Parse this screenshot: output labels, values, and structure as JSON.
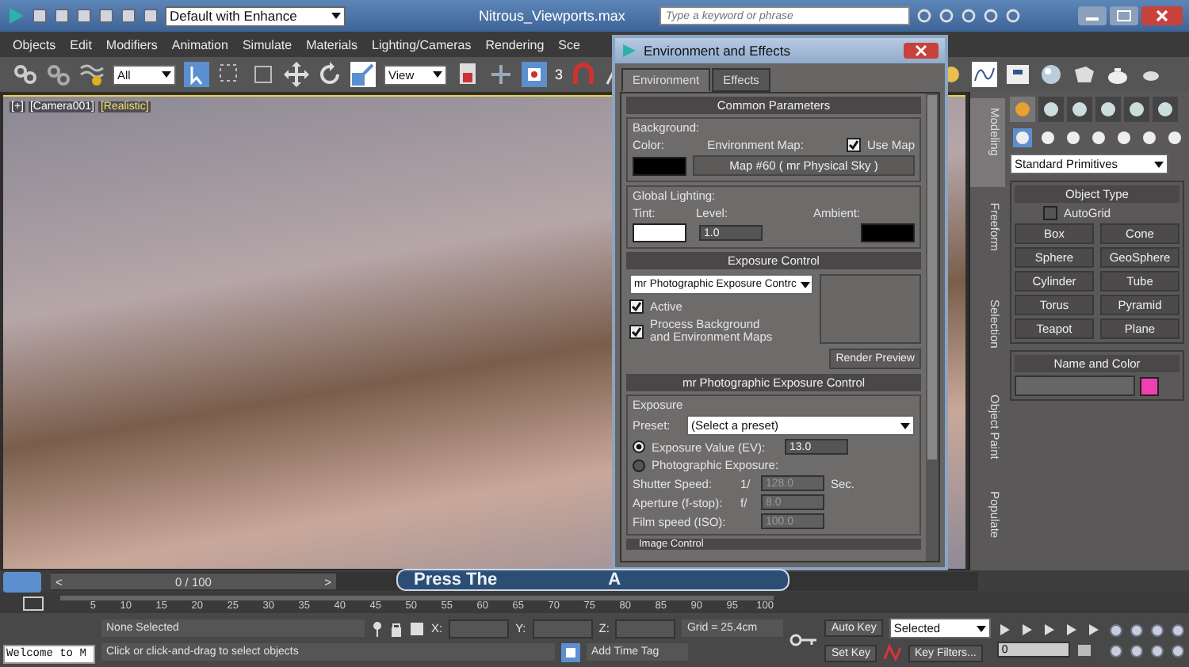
{
  "title_bar": {
    "workspace": "Default with Enhance",
    "title": "Nitrous_Viewports.max",
    "search": {
      "placeholder": "Type a keyword or phrase"
    }
  },
  "menu": [
    "Objects",
    "Edit",
    "Modifiers",
    "Animation",
    "Simulate",
    "Materials",
    "Lighting/Cameras",
    "Rendering",
    "Sce"
  ],
  "toolbar": {
    "selection_filter": "All",
    "reference_coord": "View",
    "snap": "3"
  },
  "viewport": {
    "labels": [
      "[+]",
      "[Camera001]",
      "[Realistic]"
    ]
  },
  "dialog": {
    "title": "Environment and Effects",
    "tabs": [
      {
        "label": "Environment",
        "selected": true
      },
      {
        "label": "Effects",
        "selected": false
      }
    ],
    "common": {
      "header": "Common Parameters",
      "background_label": "Background:",
      "color_label": "Color:",
      "color": "#000000",
      "env_map_label": "Environment Map:",
      "use_map": {
        "label": "Use Map",
        "checked": true
      },
      "map_button": "Map #60  ( mr Physical Sky )",
      "global_label": "Global Lighting:",
      "tint_label": "Tint:",
      "level_label": "Level:",
      "level_value": "1.0",
      "ambient_label": "Ambient:"
    },
    "exposure": {
      "header": "Exposure Control",
      "type": "mr Photographic Exposure Contrc",
      "active": {
        "label": "Active",
        "checked": true
      },
      "process": {
        "label": "Process Background and Environment Maps",
        "checked": true
      },
      "preview_button": "Render Preview"
    },
    "mr": {
      "header": "mr Photographic Exposure Control",
      "group": "Exposure",
      "preset_label": "Preset:",
      "preset_value": "(Select a preset)",
      "options": [
        {
          "label": "Exposure Value (EV):",
          "selected": true,
          "value": "13.0"
        },
        {
          "label": "Photographic Exposure:",
          "selected": false
        }
      ],
      "fields": [
        {
          "label": "Shutter Speed:",
          "prefix": "1/",
          "value": "128.0",
          "unit": "Sec.",
          "disabled": true
        },
        {
          "label": "Aperture (f-stop):",
          "prefix": "f/",
          "value": "8.0",
          "disabled": true
        },
        {
          "label": "Film speed (ISO):",
          "value": "100.0",
          "disabled": true
        }
      ],
      "next_header": "Image Control"
    }
  },
  "command_panel": {
    "side_tabs": [
      {
        "label": "Modeling",
        "selected": true
      },
      {
        "label": "Freeform",
        "selected": false
      },
      {
        "label": "Selection",
        "selected": false
      },
      {
        "label": "Object Paint",
        "selected": false
      },
      {
        "label": "Populate",
        "selected": false
      }
    ],
    "category": "Standard Primitives",
    "object_type": {
      "header": "Object Type",
      "autogrid": {
        "label": "AutoGrid",
        "checked": false
      },
      "buttons": [
        "Box",
        "Cone",
        "Sphere",
        "GeoSphere",
        "Cylinder",
        "Tube",
        "Torus",
        "Pyramid",
        "Teapot",
        "Plane"
      ]
    },
    "name_color": {
      "header": "Name and Color",
      "color": "#f040b0"
    }
  },
  "time_slider": {
    "position": "0 / 100",
    "prev": "<",
    "next": ">",
    "level": 0
  },
  "track": {
    "ticks": [
      "5",
      "10",
      "15",
      "20",
      "25",
      "30",
      "35",
      "40",
      "45",
      "50",
      "55",
      "60",
      "65",
      "70",
      "75",
      "80",
      "85",
      "90",
      "95",
      "100"
    ]
  },
  "key_overlay": {
    "text": "Press The",
    "key": "A"
  },
  "status": {
    "listener": "Welcome to M",
    "selection": "None Selected",
    "prompt": "Click or click-and-drag to select objects",
    "x_label": "X:",
    "y_label": "Y:",
    "z_label": "Z:",
    "grid": "Grid = 25.4cm",
    "add_time_tag": "Add Time Tag",
    "auto_key": "Auto Key",
    "key_mode": "Selected",
    "set_key": "Set Key",
    "key_filters": "Key Filters...",
    "frame": "0"
  }
}
